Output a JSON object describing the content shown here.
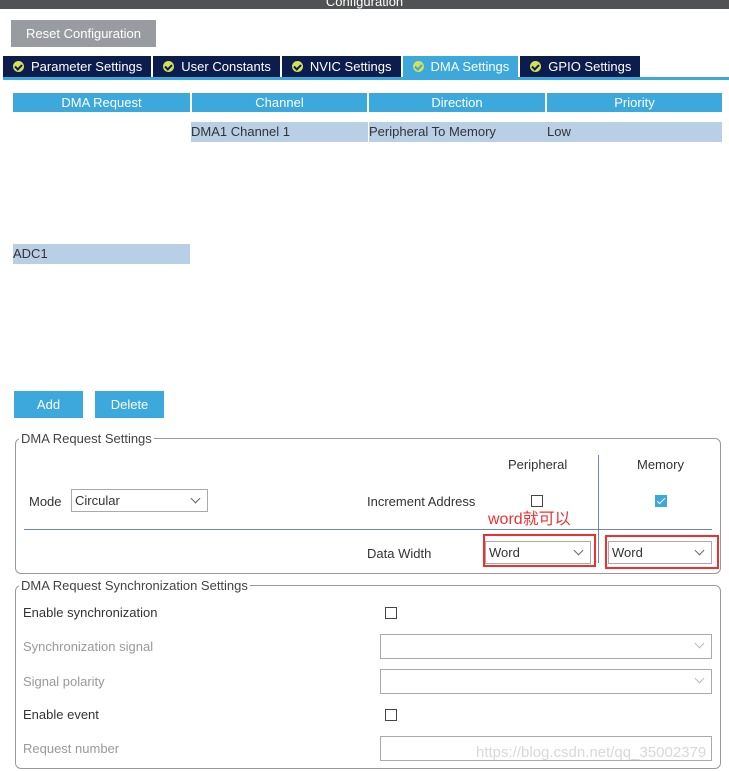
{
  "window": {
    "title": "Configuration"
  },
  "toolbar": {
    "reset_label": "Reset Configuration"
  },
  "tabs": [
    {
      "label": "Parameter Settings"
    },
    {
      "label": "User Constants"
    },
    {
      "label": "NVIC Settings"
    },
    {
      "label": "DMA Settings",
      "active": true
    },
    {
      "label": "GPIO Settings"
    }
  ],
  "table": {
    "headers": [
      "DMA Request",
      "Channel",
      "Direction",
      "Priority"
    ],
    "rows": [
      [
        "ADC1",
        "DMA1 Channel 1",
        "Peripheral To Memory",
        "Low"
      ]
    ]
  },
  "actions": {
    "add": "Add",
    "delete": "Delete"
  },
  "request_settings": {
    "legend": "DMA Request Settings",
    "peripheral": "Peripheral",
    "memory": "Memory",
    "mode_label": "Mode",
    "mode_value": "Circular",
    "increment_label": "Increment Address",
    "peripheral_increment": false,
    "memory_increment": true,
    "data_width_label": "Data Width",
    "peripheral_width": "Word",
    "memory_width": "Word",
    "annotation": "word就可以"
  },
  "sync_settings": {
    "legend": "DMA Request Synchronization Settings",
    "enable_sync": "Enable synchronization",
    "sync_signal": "Synchronization signal",
    "signal_polarity": "Signal polarity",
    "enable_event": "Enable event",
    "request_number": "Request number"
  },
  "watermark": "https://blog.csdn.net/qq_35002379",
  "colors": {
    "accent": "#3ca8dc",
    "tab_dark": "#0c1d4d",
    "row_selected": "#b9cfe6",
    "annotation": "#f03030"
  }
}
